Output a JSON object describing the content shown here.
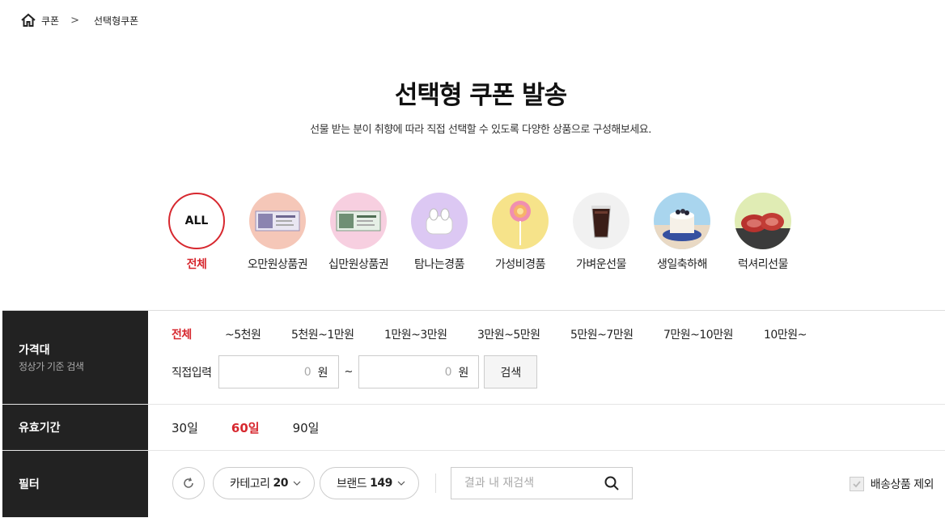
{
  "breadcrumb": {
    "home_icon": "home-icon",
    "items": [
      "쿠폰",
      "선택형쿠폰"
    ],
    "separator": ">"
  },
  "header": {
    "title": "선택형 쿠폰 발송",
    "subtitle": "선물 받는 분이 취향에 따라 직접 선택할 수 있도록 다양한 상품으로 구성해보세요."
  },
  "categories": [
    {
      "label": "전체",
      "badge": "ALL",
      "active": true
    },
    {
      "label": "오만원상품권",
      "icon": "gift-voucher-50000-image",
      "color": "#f5c7b8"
    },
    {
      "label": "십만원상품권",
      "icon": "gift-voucher-100000-image",
      "color": "#f7cfe0"
    },
    {
      "label": "탐나는경품",
      "icon": "earbuds-image",
      "color": "#dcc8f3"
    },
    {
      "label": "가성비경품",
      "icon": "lollipop-image",
      "color": "#f6e38a"
    },
    {
      "label": "가벼운선물",
      "icon": "iced-coffee-image",
      "color": "#f1f1f1"
    },
    {
      "label": "생일축하해",
      "icon": "cake-image",
      "color": "#a9d5ee"
    },
    {
      "label": "럭셔리선물",
      "icon": "steak-image",
      "color": "#e0ecb4"
    }
  ],
  "filters": {
    "price": {
      "heading": "가격대",
      "sub": "정상가 기준 검색",
      "options": [
        "전체",
        "~5천원",
        "5천원~1만원",
        "1만원~3만원",
        "3만원~5만원",
        "5만원~7만원",
        "7만원~10만원",
        "10만원~"
      ],
      "active": 0,
      "direct_label": "직접입력",
      "min_value": "0",
      "max_value": "0",
      "unit": "원",
      "range_sep": "~",
      "search_label": "검색"
    },
    "period": {
      "heading": "유효기간",
      "options": [
        "30일",
        "60일",
        "90일"
      ],
      "active": 1
    },
    "filter": {
      "heading": "필터",
      "category_label": "카테고리",
      "category_count": "20",
      "brand_label": "브랜드",
      "brand_count": "149",
      "search_placeholder": "결과 내 재검색",
      "exclude_label": "배송상품 제외",
      "exclude_checked": true
    }
  },
  "colors": {
    "accent": "#d7282f",
    "header_bg": "#222222"
  }
}
